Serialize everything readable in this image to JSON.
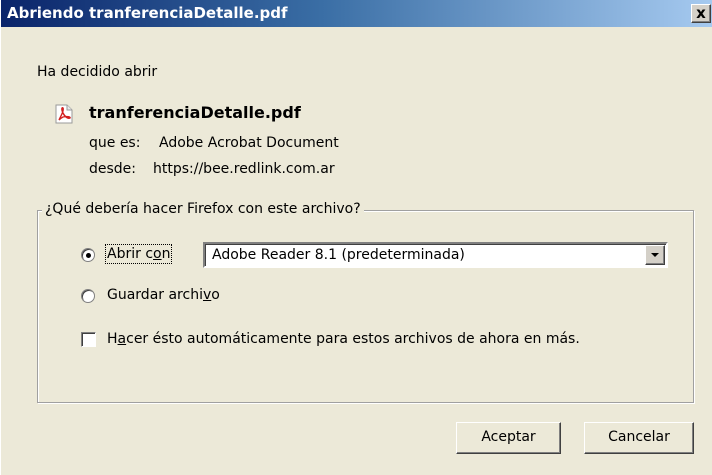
{
  "window": {
    "title": "Abriendo tranferenciaDetalle.pdf",
    "close_label": "x"
  },
  "intro": "Ha decidido abrir",
  "file": {
    "name": "tranferenciaDetalle.pdf",
    "icon": "pdf-icon",
    "type_label": "que es:",
    "type_value": "Adobe Acrobat Document",
    "from_label": "desde:",
    "from_value": "https://bee.redlink.com.ar"
  },
  "action_group": {
    "legend": "¿Qué debería hacer Firefox con este archivo?",
    "open_with": {
      "label_pre": "Abrir c",
      "label_access": "o",
      "label_post": "n",
      "selected": true,
      "app_selected": "Adobe Reader 8.1 (predeterminada)"
    },
    "save_file": {
      "label_pre": "Guardar archi",
      "label_access": "v",
      "label_post": "o",
      "selected": false
    },
    "auto": {
      "label_pre": "H",
      "label_access": "a",
      "label_post": "cer ésto automáticamente para estos archivos de ahora en más.",
      "checked": false
    }
  },
  "buttons": {
    "ok": "Aceptar",
    "cancel": "Cancelar"
  }
}
